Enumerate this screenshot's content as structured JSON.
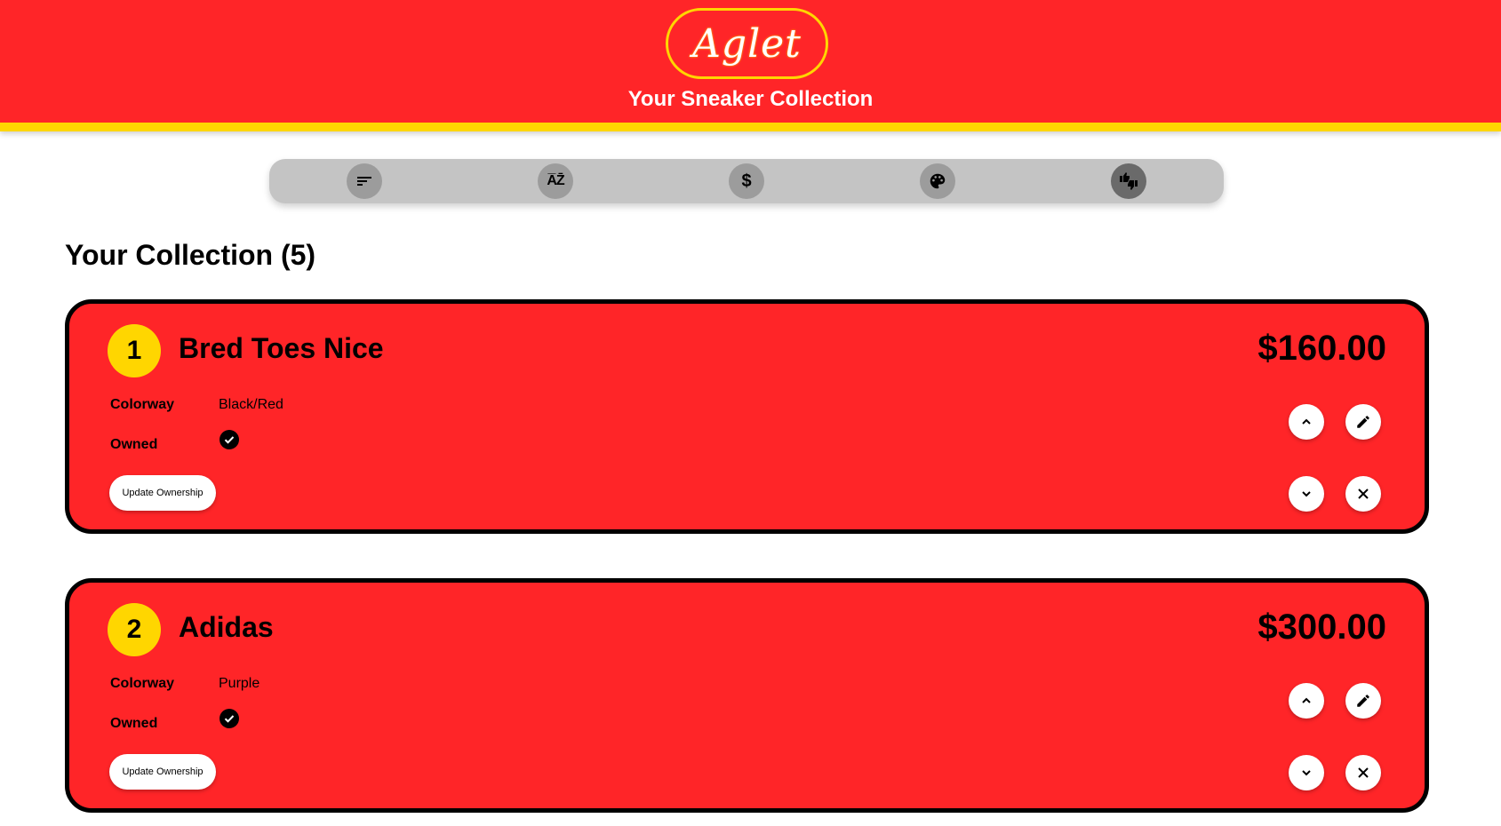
{
  "header": {
    "logo_text": "Aglet",
    "subtitle": "Your Sneaker Collection",
    "colors": {
      "brand_red": "#ff2528",
      "accent_yellow": "#ffd600"
    }
  },
  "toolbar": {
    "buttons": [
      {
        "icon": "sort-icon",
        "active": false
      },
      {
        "icon": "sort-alpha-icon",
        "active": false
      },
      {
        "icon": "dollar-icon",
        "active": false
      },
      {
        "icon": "palette-icon",
        "active": false
      },
      {
        "icon": "thumbs-up-down-icon",
        "active": true
      }
    ]
  },
  "collection": {
    "title": "Your Collection (5)",
    "labels": {
      "colorway": "Colorway",
      "owned": "Owned",
      "update": "Update Ownership"
    },
    "items": [
      {
        "rank": "1",
        "name": "Bred Toes Nice",
        "price": "$160.00",
        "colorway": "Black/Red",
        "owned": true
      },
      {
        "rank": "2",
        "name": "Adidas",
        "price": "$300.00",
        "colorway": "Purple",
        "owned": true
      }
    ]
  }
}
